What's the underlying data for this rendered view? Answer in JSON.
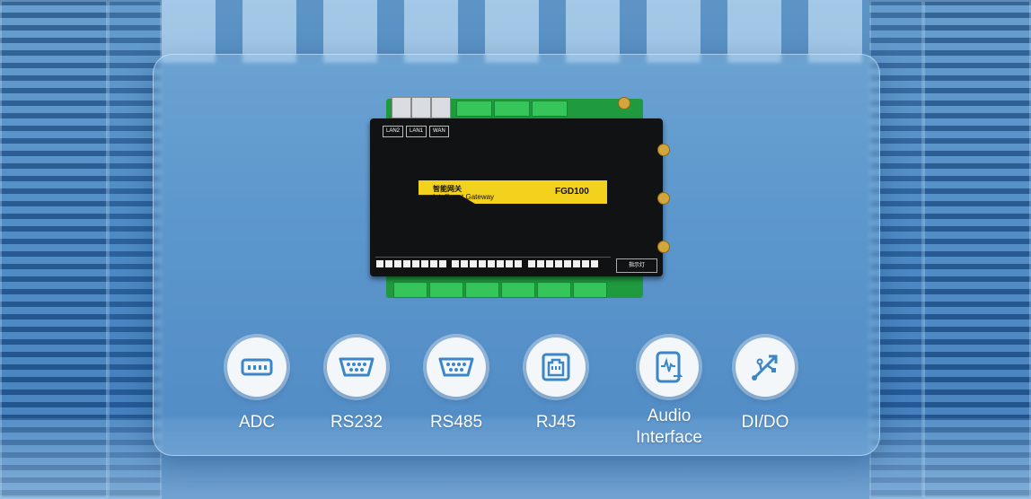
{
  "device": {
    "ports_top": [
      "LAN2",
      "LAN1",
      "WAN"
    ],
    "name_cn": "智能网关",
    "name_en": "Intelligent Gateway",
    "model": "FGD100",
    "indicator_label": "指示灯"
  },
  "features": [
    {
      "label": "ADC",
      "icon": "adc-port-icon"
    },
    {
      "label": "RS232",
      "icon": "db9-port-icon"
    },
    {
      "label": "RS485",
      "icon": "db9-port-icon"
    },
    {
      "label": "RJ45",
      "icon": "rj45-port-icon"
    },
    {
      "label": "Audio\nInterface",
      "icon": "audio-interface-icon"
    },
    {
      "label": "DI/DO",
      "icon": "usb-dido-icon"
    }
  ],
  "colors": {
    "accent": "#3a86c8",
    "stripe": "#f3d21e",
    "pcb": "#1f9a3e"
  }
}
